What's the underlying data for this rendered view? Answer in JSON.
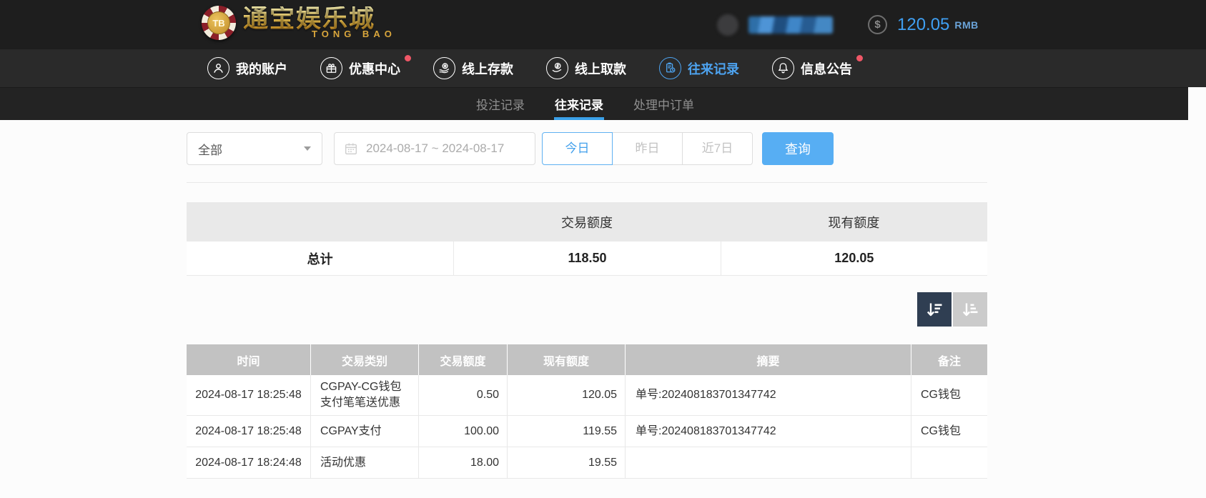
{
  "header": {
    "logo": {
      "chip_text": "TB",
      "title": "通宝娱乐城",
      "subtitle": "TONG BAO"
    },
    "balance": {
      "currency_symbol": "$",
      "amount": "120.05",
      "currency": "RMB"
    }
  },
  "nav": {
    "items": [
      {
        "label": "我的账户",
        "icon": "user-icon",
        "active": false,
        "badge": false
      },
      {
        "label": "优惠中心",
        "icon": "gift-icon",
        "active": false,
        "badge": true
      },
      {
        "label": "线上存款",
        "icon": "deposit-icon",
        "active": false,
        "badge": false
      },
      {
        "label": "线上取款",
        "icon": "withdraw-icon",
        "active": false,
        "badge": false
      },
      {
        "label": "往来记录",
        "icon": "records-icon",
        "active": true,
        "badge": false
      },
      {
        "label": "信息公告",
        "icon": "bell-icon",
        "active": false,
        "badge": true
      }
    ]
  },
  "subnav": {
    "tabs": [
      {
        "label": "投注记录",
        "active": false
      },
      {
        "label": "往来记录",
        "active": true
      },
      {
        "label": "处理中订单",
        "active": false
      }
    ]
  },
  "filters": {
    "type_select": {
      "value": "全部"
    },
    "date_range": {
      "value": "2024-08-17 ~ 2024-08-17"
    },
    "quick_ranges": [
      {
        "label": "今日",
        "active": true
      },
      {
        "label": "昨日",
        "active": false
      },
      {
        "label": "近7日",
        "active": false
      }
    ],
    "search_label": "查询"
  },
  "summary_table": {
    "headers": [
      "",
      "交易额度",
      "现有额度"
    ],
    "row": {
      "label": "总计",
      "transaction_amount": "118.50",
      "current_balance": "120.05"
    }
  },
  "records_table": {
    "headers": [
      "时间",
      "交易类别",
      "交易额度",
      "现有额度",
      "摘要",
      "备注"
    ],
    "rows": [
      [
        "2024-08-17 18:25:48",
        "CGPAY-CG钱包支付笔笔送优惠",
        "0.50",
        "120.05",
        "单号:202408183701347742",
        "CG钱包"
      ],
      [
        "2024-08-17 18:25:48",
        "CGPAY支付",
        "100.00",
        "119.55",
        "单号:202408183701347742",
        "CG钱包"
      ],
      [
        "2024-08-17 18:24:48",
        "活动优惠",
        "18.00",
        "19.55",
        "",
        ""
      ]
    ]
  },
  "colors": {
    "accent_blue": "#4da3f0",
    "balance_blue": "#3f9ff2",
    "search_button_blue": "#57aef3",
    "tab_underline_blue": "#3aa0e8",
    "badge_red": "#ef5767",
    "summary_header_bg": "#e9e9e9",
    "table_header_bg": "#c2c2c2",
    "sort_dark_bg": "#2f3e52",
    "sort_light_bg": "#cbcbcb",
    "topbar_bg": "#1e1e1e",
    "nav_bg": "#2a2a2a",
    "subnav_bg": "#232323"
  }
}
